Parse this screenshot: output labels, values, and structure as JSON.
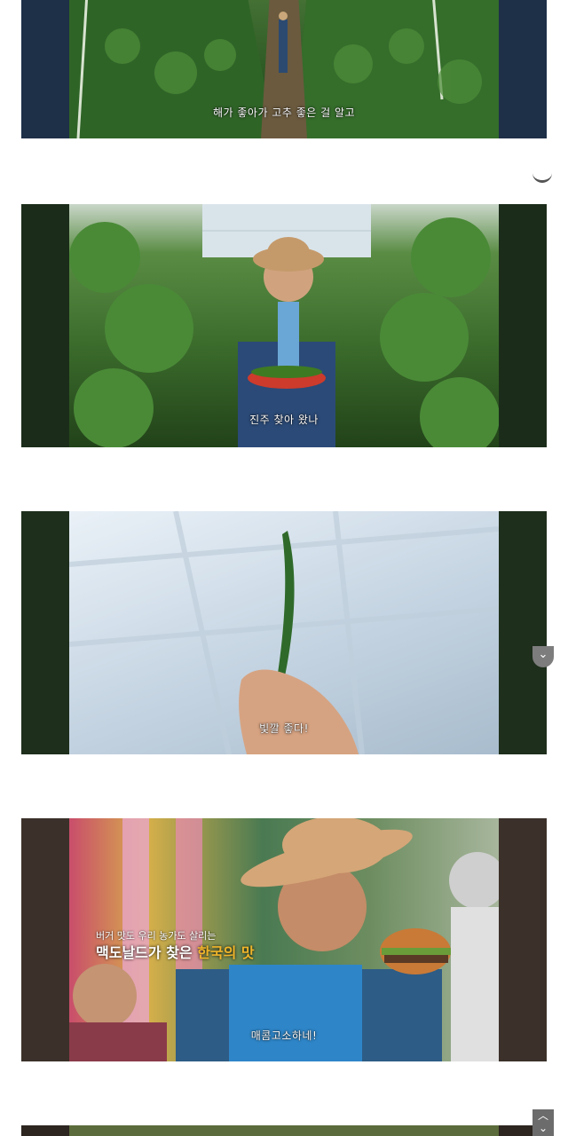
{
  "frames": [
    {
      "caption": "해가 좋아가 고추 좋은 걸 알고"
    },
    {
      "caption": "진주 찾아 왔나"
    },
    {
      "caption": "빛깔 좋다!"
    },
    {
      "caption": "매콤고소하네!",
      "overlay_subtitle": "버거 맛도 우리 농가도 살리는",
      "overlay_title_plain": "맥도날드가 찾은",
      "overlay_title_highlight": "한국의 맛"
    }
  ],
  "controls": {
    "scroll_down_glyph": "⌄",
    "scroll_top_glyph": "︿",
    "scroll_more_glyph": "⌄"
  },
  "colors": {
    "highlight": "#f0b52a",
    "button": "#7d7d7d"
  }
}
